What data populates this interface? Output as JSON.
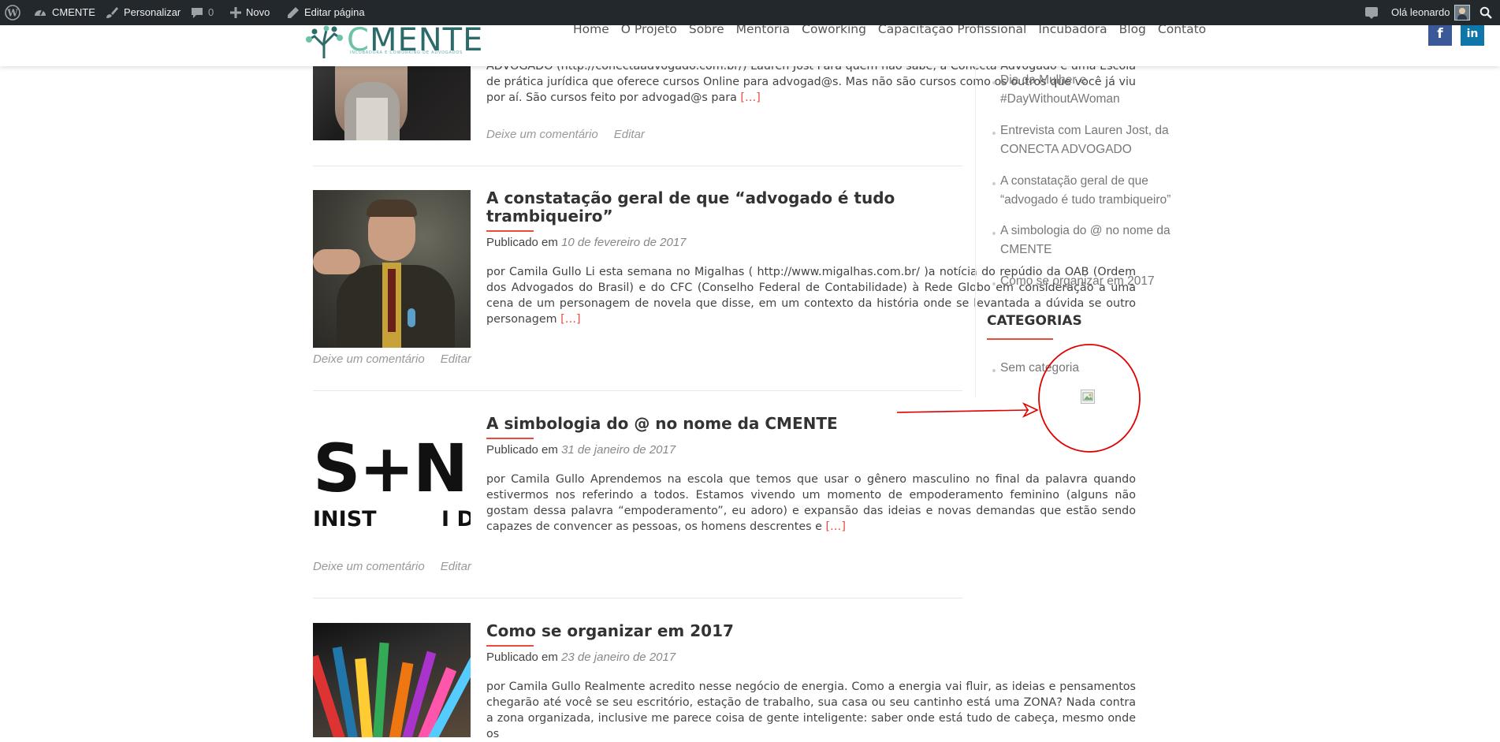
{
  "adminbar": {
    "site_name": "CMENTE",
    "customize": "Personalizar",
    "comments_count": "0",
    "new": "Novo",
    "edit_page": "Editar página",
    "greeting": "Olá leonardo"
  },
  "header": {
    "logo_text_c": "C",
    "logo_text_rest": "MENTE",
    "logo_tagline": "INCUBADORA E COWORKING DE ADVOGADOS",
    "nav": [
      "Home",
      "O Projeto",
      "Sobre",
      "Mentoria",
      "Coworking",
      "Capacitação Profissional",
      "Incubadora",
      "Blog",
      "Contato"
    ],
    "social": {
      "facebook": "f",
      "linkedin": "in"
    }
  },
  "posts": [
    {
      "excerpt_partial": "ADVOGADO (http://conectaadvogado.com.br/) Lauren Jost Para quem não sabe, a Conecta Advogado é uma Escola de prática jurídica que oferece cursos Online para advogad@s. Mas não são cursos como os outros que você já viu por aí. São cursos feito por advogad@s para",
      "more": "[…]",
      "comment": "Deixe um comentário",
      "edit": "Editar"
    },
    {
      "title": "A constatação geral de que “advogado é tudo trambiqueiro”",
      "published_label": "Publicado em",
      "date": "10 de fevereiro de 2017",
      "excerpt": "por Camila Gullo Li esta semana no Migalhas ( http://www.migalhas.com.br/ )a notícia do repúdio da OAB (Ordem dos Advogados do Brasil) e do CFC (Conselho Federal de Contabilidade) à Rede Globo em consideração a uma cena de um personagem de novela que disse, em um contexto da história onde se levantada a dúvida se outro personagem",
      "more": "[…]",
      "comment": "Deixe um comentário",
      "edit": "Editar"
    },
    {
      "title": "A simbologia do @ no nome da CMENTE",
      "published_label": "Publicado em",
      "date": "31 de janeiro de 2017",
      "excerpt": "por Camila Gullo Aprendemos na escola que temos que usar o gênero masculino no final da palavra quando estivermos nos referindo a todos. Estamos vivendo um momento de empoderamento feminino (alguns não gostam dessa palavra “empoderamento”, eu adoro) e expansão das ideias e novas demandas que estão sendo capazes de convencer as pessoas, os homens descrentes e",
      "more": "[…]",
      "comment": "Deixe um comentário",
      "edit": "Editar",
      "thumb_text_top": "S+N",
      "thumb_text_left": "INIST",
      "thumb_text_right": "I DO"
    },
    {
      "title": "Como se organizar em 2017",
      "published_label": "Publicado em",
      "date": "23 de janeiro de 2017",
      "excerpt": "por Camila Gullo Realmente acredito nesse negócio de energia. Como a energia vai fluir, as ideias e pensamentos chegarão até você se seu escritório, estação de trabalho, sua casa ou seu cantinho está uma ZONA? Nada contra a zona organizada, inclusive me parece coisa de gente inteligente: saber onde está tudo de cabeça, mesmo onde os"
    }
  ],
  "sidebar": {
    "recent": [
      "Dia da Mulher e #DayWithoutAWoman",
      "Entrevista com Lauren Jost, da CONECTA ADVOGADO",
      "A constatação geral de que “advogado é tudo trambiqueiro”",
      "A simbologia do @ no nome da CMENTE",
      "Como se organizar em 2017"
    ],
    "categories_title": "CATEGORIAS",
    "categories": [
      "Sem categoria"
    ]
  },
  "colors": {
    "adminbar_bg": "#23282d",
    "accent": "#e74c3c",
    "facebook": "#3b5998",
    "linkedin": "#0e76a8",
    "annotation": "#e00000"
  }
}
